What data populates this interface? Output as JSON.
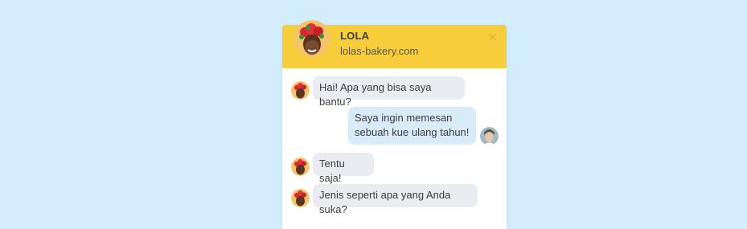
{
  "header": {
    "title": "LOLA",
    "subtitle": "lolas-bakery.com",
    "close_icon": "close-icon"
  },
  "messages": [
    {
      "from": "agent",
      "text": "Hai! Apa yang bisa saya bantu?"
    },
    {
      "from": "user",
      "text": "Saya ingin memesan\nsebuah kue ulang tahun!"
    },
    {
      "from": "agent",
      "text": "Tentu saja!"
    },
    {
      "from": "agent",
      "text": "Jenis seperti apa yang Anda suka?"
    }
  ],
  "colors": {
    "background": "#d4edfc",
    "header": "#f8cd3c",
    "agent_bubble": "#ebebf2",
    "user_bubble": "#d7ebf9"
  }
}
